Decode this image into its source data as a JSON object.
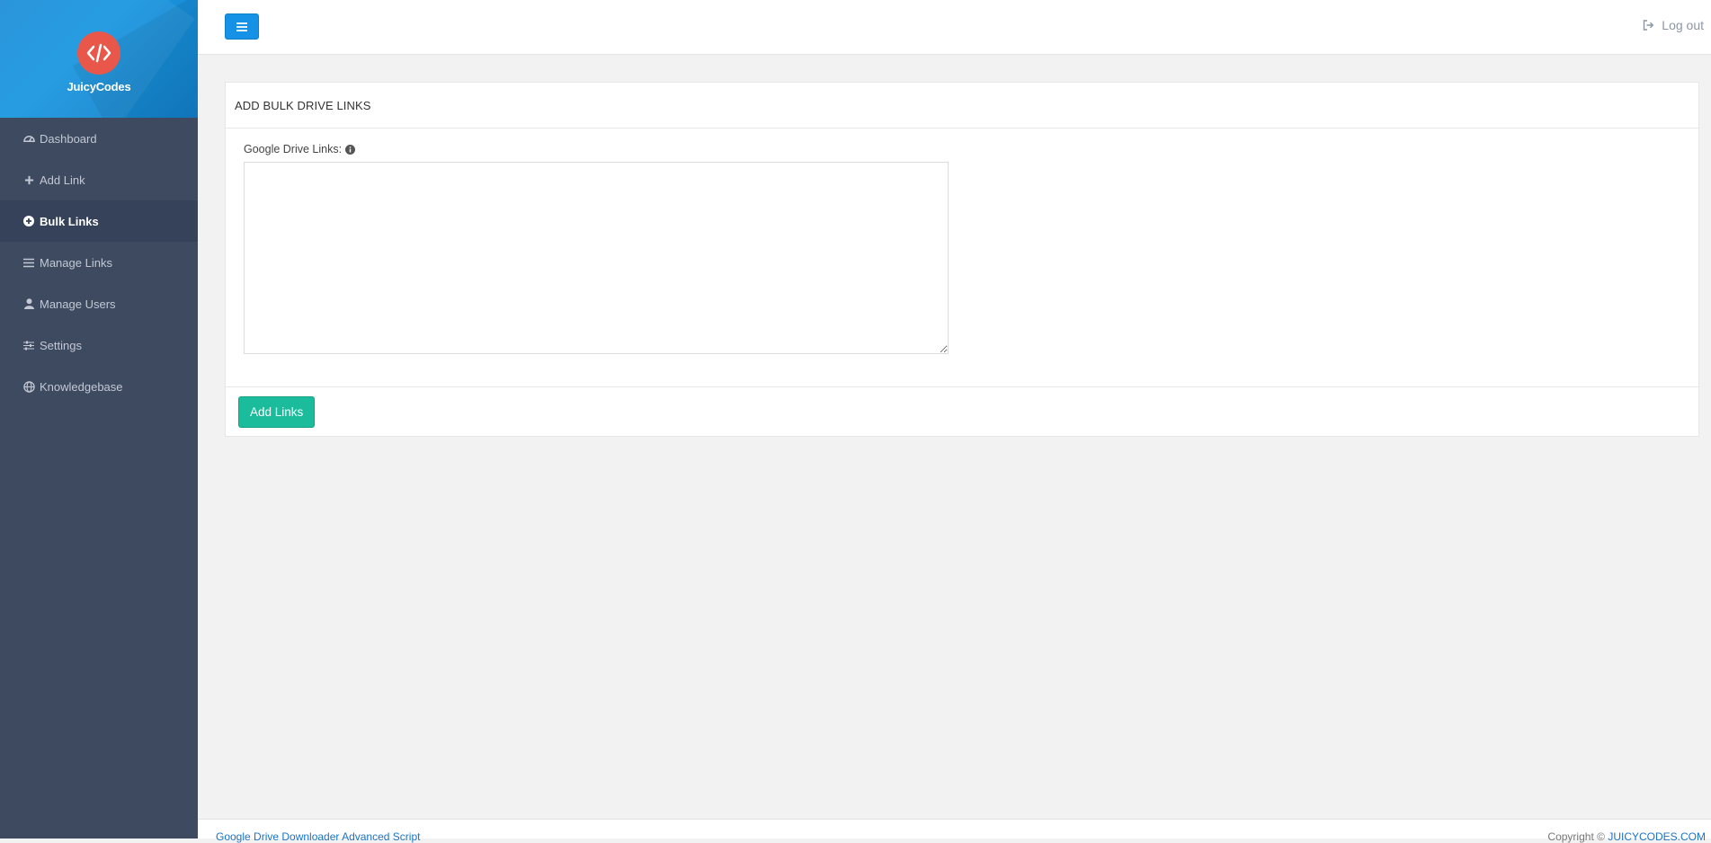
{
  "brand": {
    "name": "JuicyCodes",
    "logo_icon": "code-brackets-icon",
    "logo_color": "#e9574a"
  },
  "sidebar": {
    "items": [
      {
        "label": "Dashboard",
        "icon": "dashboard-icon",
        "active": false
      },
      {
        "label": "Add Link",
        "icon": "plus-icon",
        "active": false
      },
      {
        "label": "Bulk Links",
        "icon": "plus-circle-icon",
        "active": true
      },
      {
        "label": "Manage Links",
        "icon": "list-icon",
        "active": false
      },
      {
        "label": "Manage Users",
        "icon": "user-icon",
        "active": false
      },
      {
        "label": "Settings",
        "icon": "sliders-icon",
        "active": false
      },
      {
        "label": "Knowledgebase",
        "icon": "globe-icon",
        "active": false
      }
    ]
  },
  "topbar": {
    "logout_label": "Log out"
  },
  "panel": {
    "title": "ADD BULK DRIVE LINKS",
    "field_label": "Google Drive Links:",
    "textarea_value": "",
    "submit_label": "Add Links"
  },
  "footer": {
    "left_text": "Google Drive Downloader Advanced Script",
    "copyright_prefix": "Copyright ©",
    "copyright_link": "JUICYCODES.COM"
  },
  "colors": {
    "sidebar_bg": "#3d4a60",
    "brand_blue": "#1a97e0",
    "primary_button": "#1592e6",
    "success_button": "#1abc9c"
  }
}
